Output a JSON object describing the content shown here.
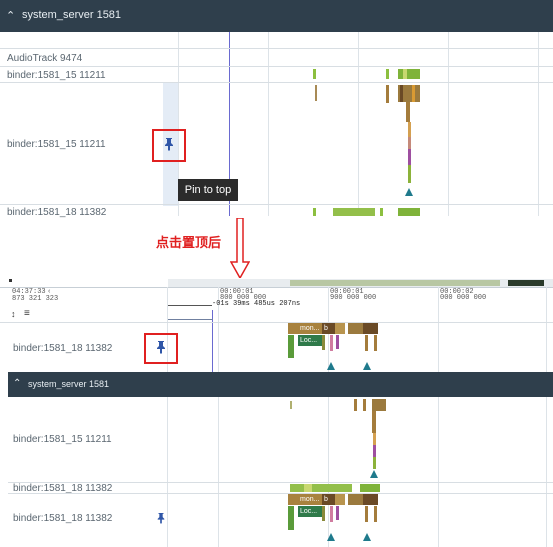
{
  "top_panel": {
    "group_header": "system_server 1581",
    "tracks": [
      "AudioTrack 9474",
      "binder:1581_15 11211",
      "binder:1581_15 11211",
      "binder:1581_18 11382"
    ],
    "tooltip": "Pin to top"
  },
  "annotation": {
    "label": "点击置顶后"
  },
  "bottom_panel": {
    "time_left_1": "04:37:33",
    "time_left_2": "873 321 323",
    "ticks": [
      {
        "label1": "00:00:01",
        "label2": "800 000 000"
      },
      {
        "label1": "00:00:01",
        "label2": "900 000 000"
      },
      {
        "label1": "00:00:02",
        "label2": "000 000 000"
      }
    ],
    "duration": "-01s 39ms 485us 207ns",
    "pinned_track": "binder:1581_18 11382",
    "group_header": "system_server 1581",
    "tracks": [
      "binder:1581_15 11211",
      "binder:1581_18 11382",
      "binder:1581_18 11382"
    ],
    "slice_labels": {
      "mon": "mon...",
      "b": "b",
      "loc": "Loc..."
    }
  },
  "colors": {
    "header_bg": "#2f3f4c",
    "highlight_red": "#e02020",
    "pin_blue": "#2f56a8",
    "flow_teal": "#1f7a8c"
  },
  "icons": [
    "chevron-up-icon",
    "pin-icon",
    "arrow-down-icon",
    "collapse-icon",
    "menu-icon"
  ]
}
